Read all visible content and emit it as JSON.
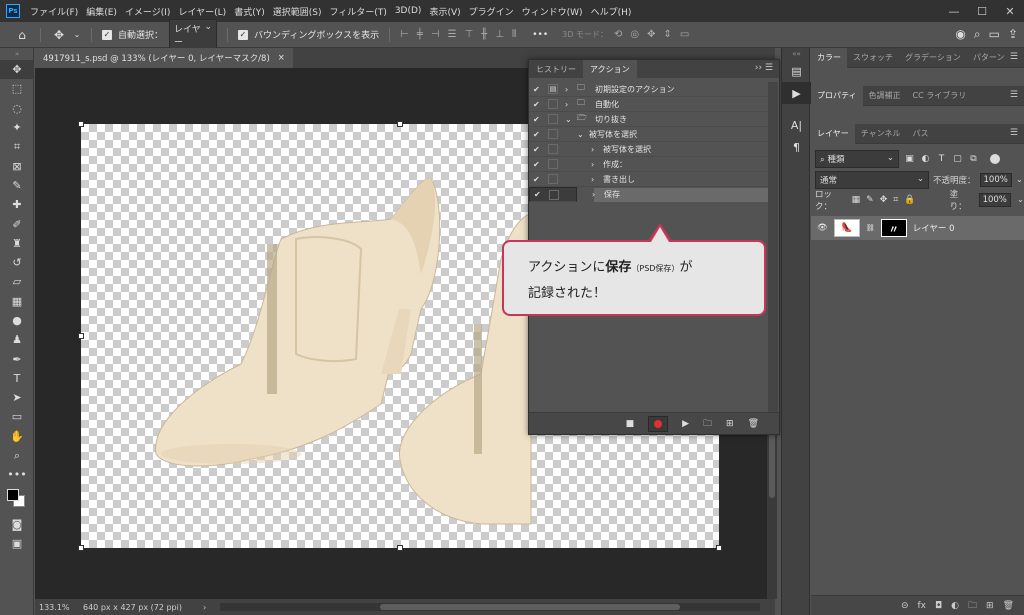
{
  "app": {
    "logo": "Ps"
  },
  "menu": [
    "ファイル(F)",
    "編集(E)",
    "イメージ(I)",
    "レイヤー(L)",
    "書式(Y)",
    "選択範囲(S)",
    "フィルター(T)",
    "3D(D)",
    "表示(V)",
    "プラグイン",
    "ウィンドウ(W)",
    "ヘルプ(H)"
  ],
  "window_controls": {
    "minimize": "—",
    "maximize": "☐",
    "close": "✕"
  },
  "options": {
    "auto_select_label": "自動選択：",
    "auto_select_target": "レイヤー",
    "bounding_box_label": "バウンディングボックスを表示",
    "more": "•••",
    "mode_3d": "3D モード："
  },
  "document": {
    "tab_title": "4917911_s.psd @ 133% (レイヤー 0, レイヤーマスク/8)",
    "tab_close": "×"
  },
  "status": {
    "zoom": "133.1%",
    "info": "640 px x 427 px (72 ppi)",
    "arrow": "›"
  },
  "actions_panel": {
    "tabs": [
      "ヒストリー",
      "アクション"
    ],
    "active_tab": "アクション",
    "menu": "›› ☰",
    "rows": [
      {
        "label": "初期設定のアクション",
        "check": "✔",
        "arrow": "›",
        "folder": "🗀",
        "dialog": true
      },
      {
        "label": "自動化",
        "check": "✔",
        "arrow": "›",
        "folder": "🗀",
        "dialog": false
      },
      {
        "label": "切り抜き",
        "check": "✔",
        "arrow": "⌄",
        "folder": "🗁",
        "dialog": false
      },
      {
        "label": "被写体を選択",
        "check": "✔",
        "arrow": "⌄",
        "dialog": false
      },
      {
        "label": "被写体を選択",
        "check": "✔",
        "arrow": "›",
        "dialog": false
      },
      {
        "label": "作成：",
        "check": "✔",
        "arrow": "›",
        "dialog": false
      },
      {
        "label": "書き出し",
        "check": "✔",
        "arrow": "›",
        "dialog": false
      },
      {
        "label": "保存",
        "check": "✔",
        "arrow": "›",
        "dialog": false,
        "selected": true
      }
    ],
    "footer": [
      "■",
      "",
      "▶",
      "🗀",
      "⊞",
      "🗑"
    ]
  },
  "callout": {
    "line1_pre": "アクションに",
    "line1_bold": "保存",
    "line1_small": "（PSD保存）",
    "line1_post": "が",
    "line2": "記録された！"
  },
  "right_panel": {
    "top_tabs": [
      "カラー",
      "スウォッチ",
      "グラデーション",
      "パターン"
    ],
    "mid_tabs": [
      "プロパティ",
      "色調補正",
      "CC ライブラリ"
    ],
    "layer_tabs": [
      "レイヤー",
      "チャンネル",
      "パス"
    ],
    "filter_label": "種類",
    "blend_mode": "通常",
    "opacity_label": "不透明度：",
    "opacity_value": "100%",
    "lock_label": "ロック：",
    "fill_label": "塗り：",
    "fill_value": "100%",
    "layer_name": "レイヤー 0",
    "footer": [
      "⊝",
      "fx",
      "◘",
      "◐",
      "🗀",
      "⊞",
      "🗑"
    ]
  },
  "colors": {
    "accent": "#c7355a",
    "record": "#e03030",
    "canvas_bg": "#282828"
  }
}
